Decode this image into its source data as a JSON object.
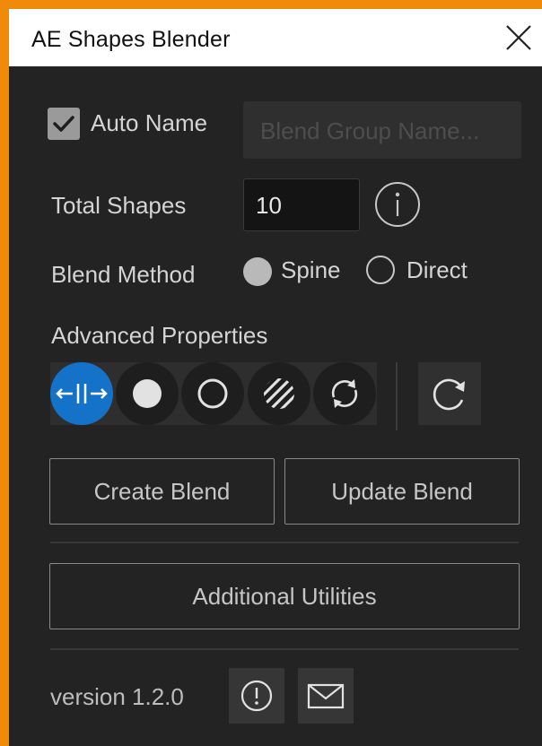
{
  "window": {
    "title": "AE Shapes Blender"
  },
  "auto_name": {
    "label": "Auto Name",
    "checked": true
  },
  "blend_group_name": {
    "placeholder": "Blend Group Name...",
    "value": ""
  },
  "total_shapes": {
    "label": "Total Shapes",
    "value": "10"
  },
  "blend_method": {
    "label": "Blend Method",
    "options": [
      "Spine",
      "Direct"
    ],
    "selected": "Spine"
  },
  "advanced_properties": {
    "label": "Advanced Properties",
    "icons": [
      "spread-icon",
      "filled-circle-icon",
      "outline-circle-icon",
      "striped-circle-icon",
      "cycle-icon",
      "reset-icon"
    ],
    "active": "spread-icon"
  },
  "buttons": {
    "create": "Create Blend",
    "update": "Update Blend",
    "utilities": "Additional Utilities"
  },
  "footer": {
    "version": "version 1.2.0"
  },
  "colors": {
    "accent": "#1473c8",
    "background": "#232323",
    "frame": "#f08a0b"
  }
}
